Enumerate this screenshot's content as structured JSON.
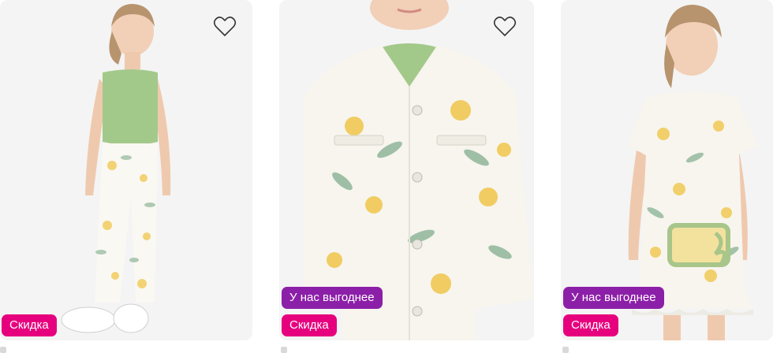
{
  "cards": [
    {
      "badges": {
        "sale": "Скидка"
      },
      "icons": {
        "favorite": "heart-outline-icon"
      },
      "photo": "girl-green-top-floral-leggings"
    },
    {
      "badges": {
        "promo": "У нас выгоднее",
        "sale": "Скидка"
      },
      "icons": {
        "favorite": "heart-outline-icon"
      },
      "photo": "floral-shirt-jacket-closeup"
    },
    {
      "badges": {
        "promo": "У нас выгоднее",
        "sale": "Скидка"
      },
      "photo": "girl-floral-dress-with-bag"
    }
  ],
  "colors": {
    "sale_badge": "#e6007e",
    "promo_badge": "#8c1fa8",
    "card_bg": "#f4f4f4",
    "leaf_green": "#a3c98a",
    "flower_yellow": "#f0c64a"
  }
}
